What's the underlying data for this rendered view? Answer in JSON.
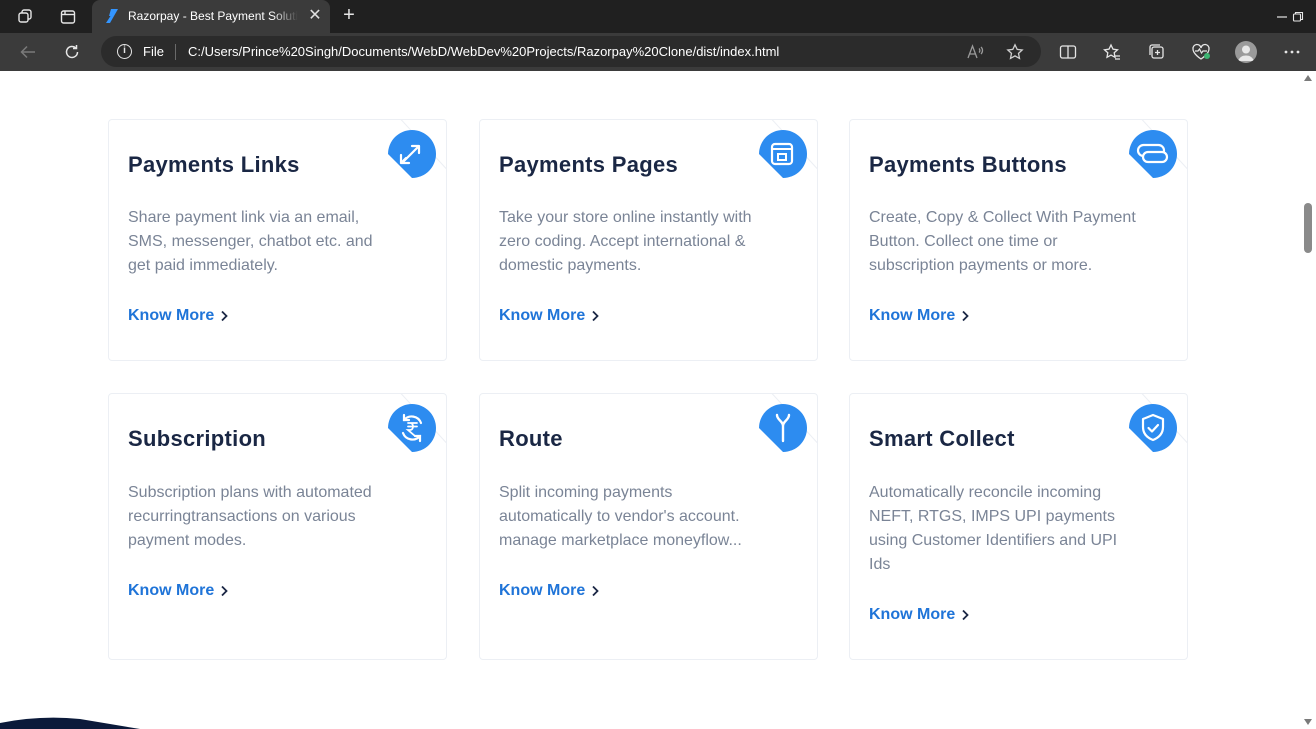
{
  "browser": {
    "tab_title": "Razorpay - Best Payment Solution for Online Payments India",
    "file_label": "File",
    "url": "C:/Users/Prince%20Singh/Documents/WebD/WebDev%20Projects/Razorpay%20Clone/dist/index.html"
  },
  "cards": [
    {
      "title": "Payments Links",
      "description": "Share payment link via an email, SMS, messenger, chatbot etc. and get paid immediately.",
      "link": "Know More",
      "icon": "payment-link-icon"
    },
    {
      "title": "Payments Pages",
      "description": "Take your store online instantly with zero coding. Accept international & domestic payments.",
      "link": "Know More",
      "icon": "payment-page-icon"
    },
    {
      "title": "Payments Buttons",
      "description": "Create, Copy & Collect With Payment Button. Collect one time or subscription payments or more.",
      "link": "Know More",
      "icon": "payment-button-icon"
    },
    {
      "title": "Subscription",
      "description": "Subscription plans with automated recurringtransactions on various payment modes.",
      "link": "Know More",
      "icon": "rupee-cycle-icon"
    },
    {
      "title": "Route",
      "description": "Split incoming payments automatically to vendor's account. manage marketplace moneyflow...",
      "link": "Know More",
      "icon": "route-split-icon"
    },
    {
      "title": "Smart Collect",
      "description": "Automatically reconcile incoming NEFT, RTGS, IMPS UPI payments using Customer Identifiers and UPI Ids",
      "link": "Know More",
      "icon": "shield-check-icon"
    }
  ],
  "colors": {
    "accent": "#1f74d8",
    "icon_bg": "#2d8cf0",
    "title": "#1a2744",
    "body_text": "#7a8496"
  }
}
